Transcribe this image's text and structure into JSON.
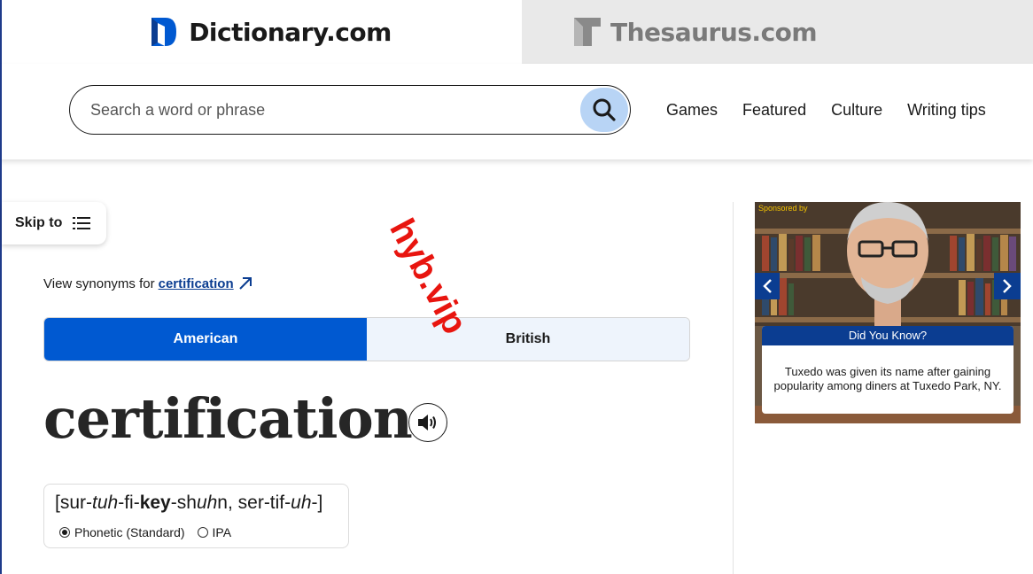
{
  "site_tabs": {
    "dictionary": "Dictionary.com",
    "thesaurus": "Thesaurus.com"
  },
  "search": {
    "placeholder": "Search a word or phrase"
  },
  "nav": {
    "items": [
      "Games",
      "Featured",
      "Culture",
      "Writing tips"
    ]
  },
  "skip": {
    "label": "Skip to"
  },
  "watermark": "hyb.vip",
  "synonyms": {
    "prefix": "View synonyms for",
    "word": "certification"
  },
  "dialect_toggle": {
    "american": "American",
    "british": "British",
    "selected": "American"
  },
  "entry": {
    "headword": "certification"
  },
  "pronunciation": {
    "parts": [
      "[sur-",
      "tuh",
      "-fi-",
      "key",
      "-sh",
      "uh",
      "n, ser-tif-",
      "uh",
      "-]"
    ],
    "option_phonetic": "Phonetic (Standard)",
    "option_ipa": "IPA",
    "selected": "Phonetic (Standard)"
  },
  "ad": {
    "sponsor": "Sponsored by",
    "card_title": "Did You Know?",
    "card_text": "Tuxedo was given its name after gaining popularity among diners at Tuxedo Park, NY."
  },
  "colors": {
    "brand_blue": "#0059d1",
    "dark_blue": "#0b3d91",
    "search_button": "#b8d4f5",
    "watermark_red": "#e8150f"
  }
}
